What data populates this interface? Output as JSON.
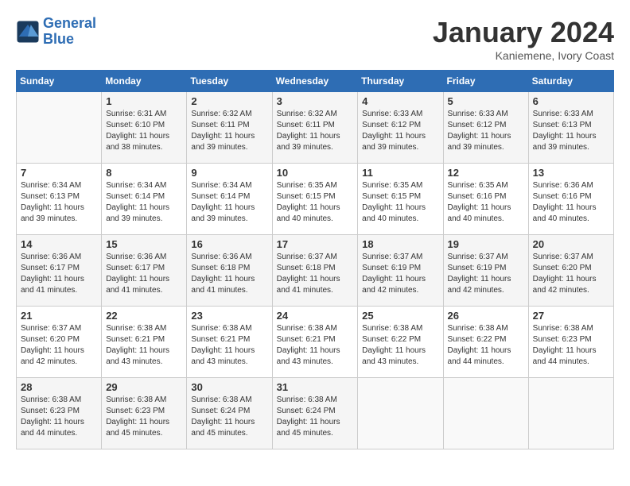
{
  "header": {
    "logo_line1": "General",
    "logo_line2": "Blue",
    "month": "January 2024",
    "location": "Kaniemene, Ivory Coast"
  },
  "days_of_week": [
    "Sunday",
    "Monday",
    "Tuesday",
    "Wednesday",
    "Thursday",
    "Friday",
    "Saturday"
  ],
  "weeks": [
    [
      {
        "day": "",
        "sunrise": "",
        "sunset": "",
        "daylight": ""
      },
      {
        "day": "1",
        "sunrise": "Sunrise: 6:31 AM",
        "sunset": "Sunset: 6:10 PM",
        "daylight": "Daylight: 11 hours and 38 minutes."
      },
      {
        "day": "2",
        "sunrise": "Sunrise: 6:32 AM",
        "sunset": "Sunset: 6:11 PM",
        "daylight": "Daylight: 11 hours and 39 minutes."
      },
      {
        "day": "3",
        "sunrise": "Sunrise: 6:32 AM",
        "sunset": "Sunset: 6:11 PM",
        "daylight": "Daylight: 11 hours and 39 minutes."
      },
      {
        "day": "4",
        "sunrise": "Sunrise: 6:33 AM",
        "sunset": "Sunset: 6:12 PM",
        "daylight": "Daylight: 11 hours and 39 minutes."
      },
      {
        "day": "5",
        "sunrise": "Sunrise: 6:33 AM",
        "sunset": "Sunset: 6:12 PM",
        "daylight": "Daylight: 11 hours and 39 minutes."
      },
      {
        "day": "6",
        "sunrise": "Sunrise: 6:33 AM",
        "sunset": "Sunset: 6:13 PM",
        "daylight": "Daylight: 11 hours and 39 minutes."
      }
    ],
    [
      {
        "day": "7",
        "sunrise": "Sunrise: 6:34 AM",
        "sunset": "Sunset: 6:13 PM",
        "daylight": "Daylight: 11 hours and 39 minutes."
      },
      {
        "day": "8",
        "sunrise": "Sunrise: 6:34 AM",
        "sunset": "Sunset: 6:14 PM",
        "daylight": "Daylight: 11 hours and 39 minutes."
      },
      {
        "day": "9",
        "sunrise": "Sunrise: 6:34 AM",
        "sunset": "Sunset: 6:14 PM",
        "daylight": "Daylight: 11 hours and 39 minutes."
      },
      {
        "day": "10",
        "sunrise": "Sunrise: 6:35 AM",
        "sunset": "Sunset: 6:15 PM",
        "daylight": "Daylight: 11 hours and 40 minutes."
      },
      {
        "day": "11",
        "sunrise": "Sunrise: 6:35 AM",
        "sunset": "Sunset: 6:15 PM",
        "daylight": "Daylight: 11 hours and 40 minutes."
      },
      {
        "day": "12",
        "sunrise": "Sunrise: 6:35 AM",
        "sunset": "Sunset: 6:16 PM",
        "daylight": "Daylight: 11 hours and 40 minutes."
      },
      {
        "day": "13",
        "sunrise": "Sunrise: 6:36 AM",
        "sunset": "Sunset: 6:16 PM",
        "daylight": "Daylight: 11 hours and 40 minutes."
      }
    ],
    [
      {
        "day": "14",
        "sunrise": "Sunrise: 6:36 AM",
        "sunset": "Sunset: 6:17 PM",
        "daylight": "Daylight: 11 hours and 41 minutes."
      },
      {
        "day": "15",
        "sunrise": "Sunrise: 6:36 AM",
        "sunset": "Sunset: 6:17 PM",
        "daylight": "Daylight: 11 hours and 41 minutes."
      },
      {
        "day": "16",
        "sunrise": "Sunrise: 6:36 AM",
        "sunset": "Sunset: 6:18 PM",
        "daylight": "Daylight: 11 hours and 41 minutes."
      },
      {
        "day": "17",
        "sunrise": "Sunrise: 6:37 AM",
        "sunset": "Sunset: 6:18 PM",
        "daylight": "Daylight: 11 hours and 41 minutes."
      },
      {
        "day": "18",
        "sunrise": "Sunrise: 6:37 AM",
        "sunset": "Sunset: 6:19 PM",
        "daylight": "Daylight: 11 hours and 42 minutes."
      },
      {
        "day": "19",
        "sunrise": "Sunrise: 6:37 AM",
        "sunset": "Sunset: 6:19 PM",
        "daylight": "Daylight: 11 hours and 42 minutes."
      },
      {
        "day": "20",
        "sunrise": "Sunrise: 6:37 AM",
        "sunset": "Sunset: 6:20 PM",
        "daylight": "Daylight: 11 hours and 42 minutes."
      }
    ],
    [
      {
        "day": "21",
        "sunrise": "Sunrise: 6:37 AM",
        "sunset": "Sunset: 6:20 PM",
        "daylight": "Daylight: 11 hours and 42 minutes."
      },
      {
        "day": "22",
        "sunrise": "Sunrise: 6:38 AM",
        "sunset": "Sunset: 6:21 PM",
        "daylight": "Daylight: 11 hours and 43 minutes."
      },
      {
        "day": "23",
        "sunrise": "Sunrise: 6:38 AM",
        "sunset": "Sunset: 6:21 PM",
        "daylight": "Daylight: 11 hours and 43 minutes."
      },
      {
        "day": "24",
        "sunrise": "Sunrise: 6:38 AM",
        "sunset": "Sunset: 6:21 PM",
        "daylight": "Daylight: 11 hours and 43 minutes."
      },
      {
        "day": "25",
        "sunrise": "Sunrise: 6:38 AM",
        "sunset": "Sunset: 6:22 PM",
        "daylight": "Daylight: 11 hours and 43 minutes."
      },
      {
        "day": "26",
        "sunrise": "Sunrise: 6:38 AM",
        "sunset": "Sunset: 6:22 PM",
        "daylight": "Daylight: 11 hours and 44 minutes."
      },
      {
        "day": "27",
        "sunrise": "Sunrise: 6:38 AM",
        "sunset": "Sunset: 6:23 PM",
        "daylight": "Daylight: 11 hours and 44 minutes."
      }
    ],
    [
      {
        "day": "28",
        "sunrise": "Sunrise: 6:38 AM",
        "sunset": "Sunset: 6:23 PM",
        "daylight": "Daylight: 11 hours and 44 minutes."
      },
      {
        "day": "29",
        "sunrise": "Sunrise: 6:38 AM",
        "sunset": "Sunset: 6:23 PM",
        "daylight": "Daylight: 11 hours and 45 minutes."
      },
      {
        "day": "30",
        "sunrise": "Sunrise: 6:38 AM",
        "sunset": "Sunset: 6:24 PM",
        "daylight": "Daylight: 11 hours and 45 minutes."
      },
      {
        "day": "31",
        "sunrise": "Sunrise: 6:38 AM",
        "sunset": "Sunset: 6:24 PM",
        "daylight": "Daylight: 11 hours and 45 minutes."
      },
      {
        "day": "",
        "sunrise": "",
        "sunset": "",
        "daylight": ""
      },
      {
        "day": "",
        "sunrise": "",
        "sunset": "",
        "daylight": ""
      },
      {
        "day": "",
        "sunrise": "",
        "sunset": "",
        "daylight": ""
      }
    ]
  ]
}
